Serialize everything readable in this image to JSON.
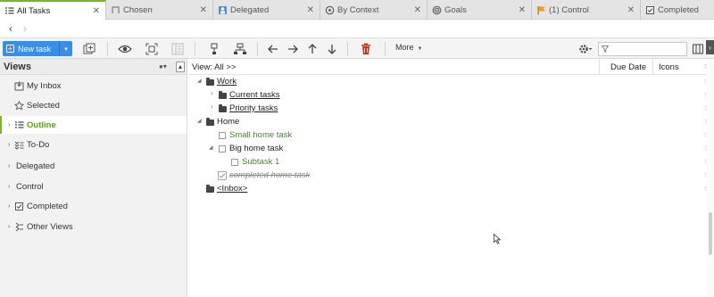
{
  "tabs": [
    {
      "label": "All Tasks",
      "icon": "outline-icon",
      "active": true
    },
    {
      "label": "Chosen",
      "icon": "chosen-icon",
      "active": false
    },
    {
      "label": "Delegated",
      "icon": "delegated-icon",
      "active": false
    },
    {
      "label": "By Context",
      "icon": "context-icon",
      "active": false
    },
    {
      "label": "Goals",
      "icon": "goals-icon",
      "active": false
    },
    {
      "label": "(1) Control",
      "icon": "flag-icon",
      "active": false
    },
    {
      "label": "Completed",
      "icon": "completed-icon",
      "active": false
    }
  ],
  "toolbar": {
    "new_task_label": "New task",
    "more_label": "More",
    "filter_placeholder": ""
  },
  "sidebar": {
    "title": "Views",
    "items": [
      {
        "label": "My Inbox",
        "icon": "inbox-icon",
        "expandable": false
      },
      {
        "label": "Selected",
        "icon": "star-outline-icon",
        "expandable": false
      },
      {
        "label": "Outline",
        "icon": "outline-list-icon",
        "expandable": true,
        "active": true
      },
      {
        "label": "To-Do",
        "icon": "todo-icon",
        "expandable": true
      },
      {
        "label": "Delegated",
        "icon": "",
        "expandable": true
      },
      {
        "label": "Control",
        "icon": "",
        "expandable": true
      },
      {
        "label": "Completed",
        "icon": "checkbox-checked-icon",
        "expandable": true
      },
      {
        "label": "Other Views",
        "icon": "other-views-icon",
        "expandable": true
      }
    ]
  },
  "main": {
    "view_label": "View: All >>",
    "columns": {
      "due_date": "Due Date",
      "icons": "Icons"
    },
    "tree": [
      {
        "label": "Work",
        "kind": "folder",
        "level": 0,
        "expander": "open"
      },
      {
        "label": "Current tasks",
        "kind": "folder",
        "level": 1,
        "expander": "closed"
      },
      {
        "label": "Priority tasks",
        "kind": "folder",
        "level": 1,
        "expander": "closed"
      },
      {
        "label": "Home",
        "kind": "folder",
        "level": 0,
        "expander": "open"
      },
      {
        "label": "Small home task",
        "kind": "task",
        "level": 1,
        "expander": "none"
      },
      {
        "label": "Big home task",
        "kind": "task-parent",
        "level": 1,
        "expander": "open"
      },
      {
        "label": "Subtask 1",
        "kind": "task",
        "level": 2,
        "expander": "none"
      },
      {
        "label": "completed home task",
        "kind": "done",
        "level": 1,
        "expander": "none"
      },
      {
        "label": "<Inbox>",
        "kind": "folder",
        "level": 0,
        "expander": "none"
      }
    ]
  },
  "colors": {
    "accent_green": "#79b52a",
    "task_green": "#3f8f1b",
    "new_task_blue": "#3a8ee6",
    "delete_red": "#c0392b",
    "flag_orange": "#f39c12"
  }
}
